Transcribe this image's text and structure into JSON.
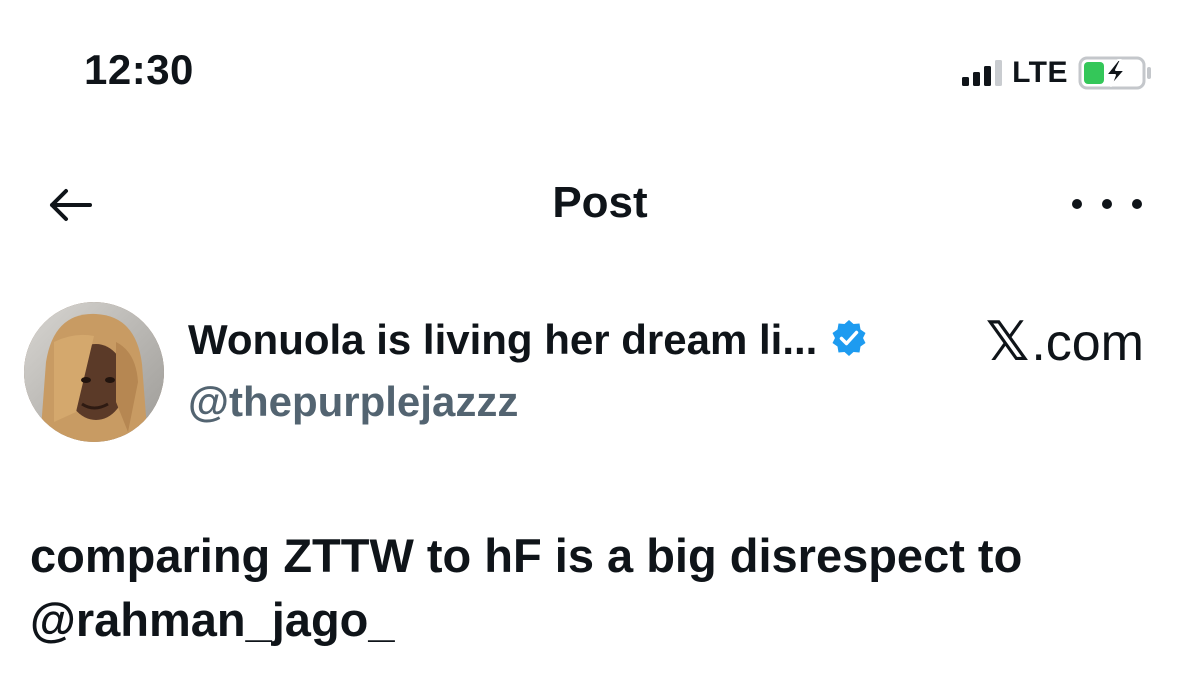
{
  "status_bar": {
    "time": "12:30",
    "network": "LTE",
    "signal_bars_active": 3,
    "battery_charging": true,
    "battery_color": "#34c759"
  },
  "header": {
    "title": "Post",
    "back_icon": "arrow-left-icon",
    "more_icon": "more-horizontal-icon"
  },
  "author": {
    "display_name": "Wonuola is living her dream li...",
    "handle": "@thepurplejazzz",
    "verified": true,
    "verified_color": "#1d9bf0"
  },
  "source": {
    "logo_text": "𝕏",
    "suffix": ".com"
  },
  "post": {
    "text_line1": "comparing ZTTW to hF is a big disrespect to",
    "mention": "@rahman_jago_"
  }
}
